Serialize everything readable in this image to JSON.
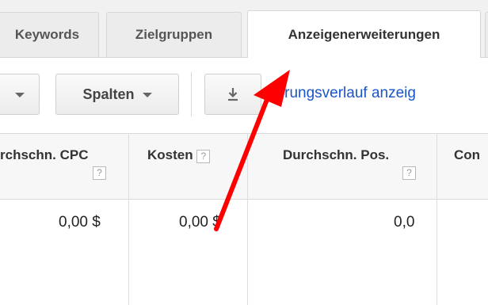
{
  "tabs": {
    "keywords": "Keywords",
    "zielgruppen": "Zielgruppen",
    "anzeigenerweiterungen": "Anzeigenerweiterungen"
  },
  "toolbar": {
    "spalten_label": "Spalten",
    "history_link": "derungsverlauf anzeig"
  },
  "table": {
    "headers": {
      "cpc": "rchschn. CPC",
      "kosten": "Kosten",
      "pos": "Durchschn. Pos.",
      "conv": "Con"
    },
    "help_mark": "?",
    "row": {
      "cpc": "0,00 $",
      "kosten": "0,00 $",
      "pos": "0,0"
    }
  },
  "colors": {
    "link": "#1a55c9",
    "arrow": "#ff0000"
  },
  "icons": {
    "dropdown": "chevron-down-icon",
    "download": "download-icon"
  }
}
